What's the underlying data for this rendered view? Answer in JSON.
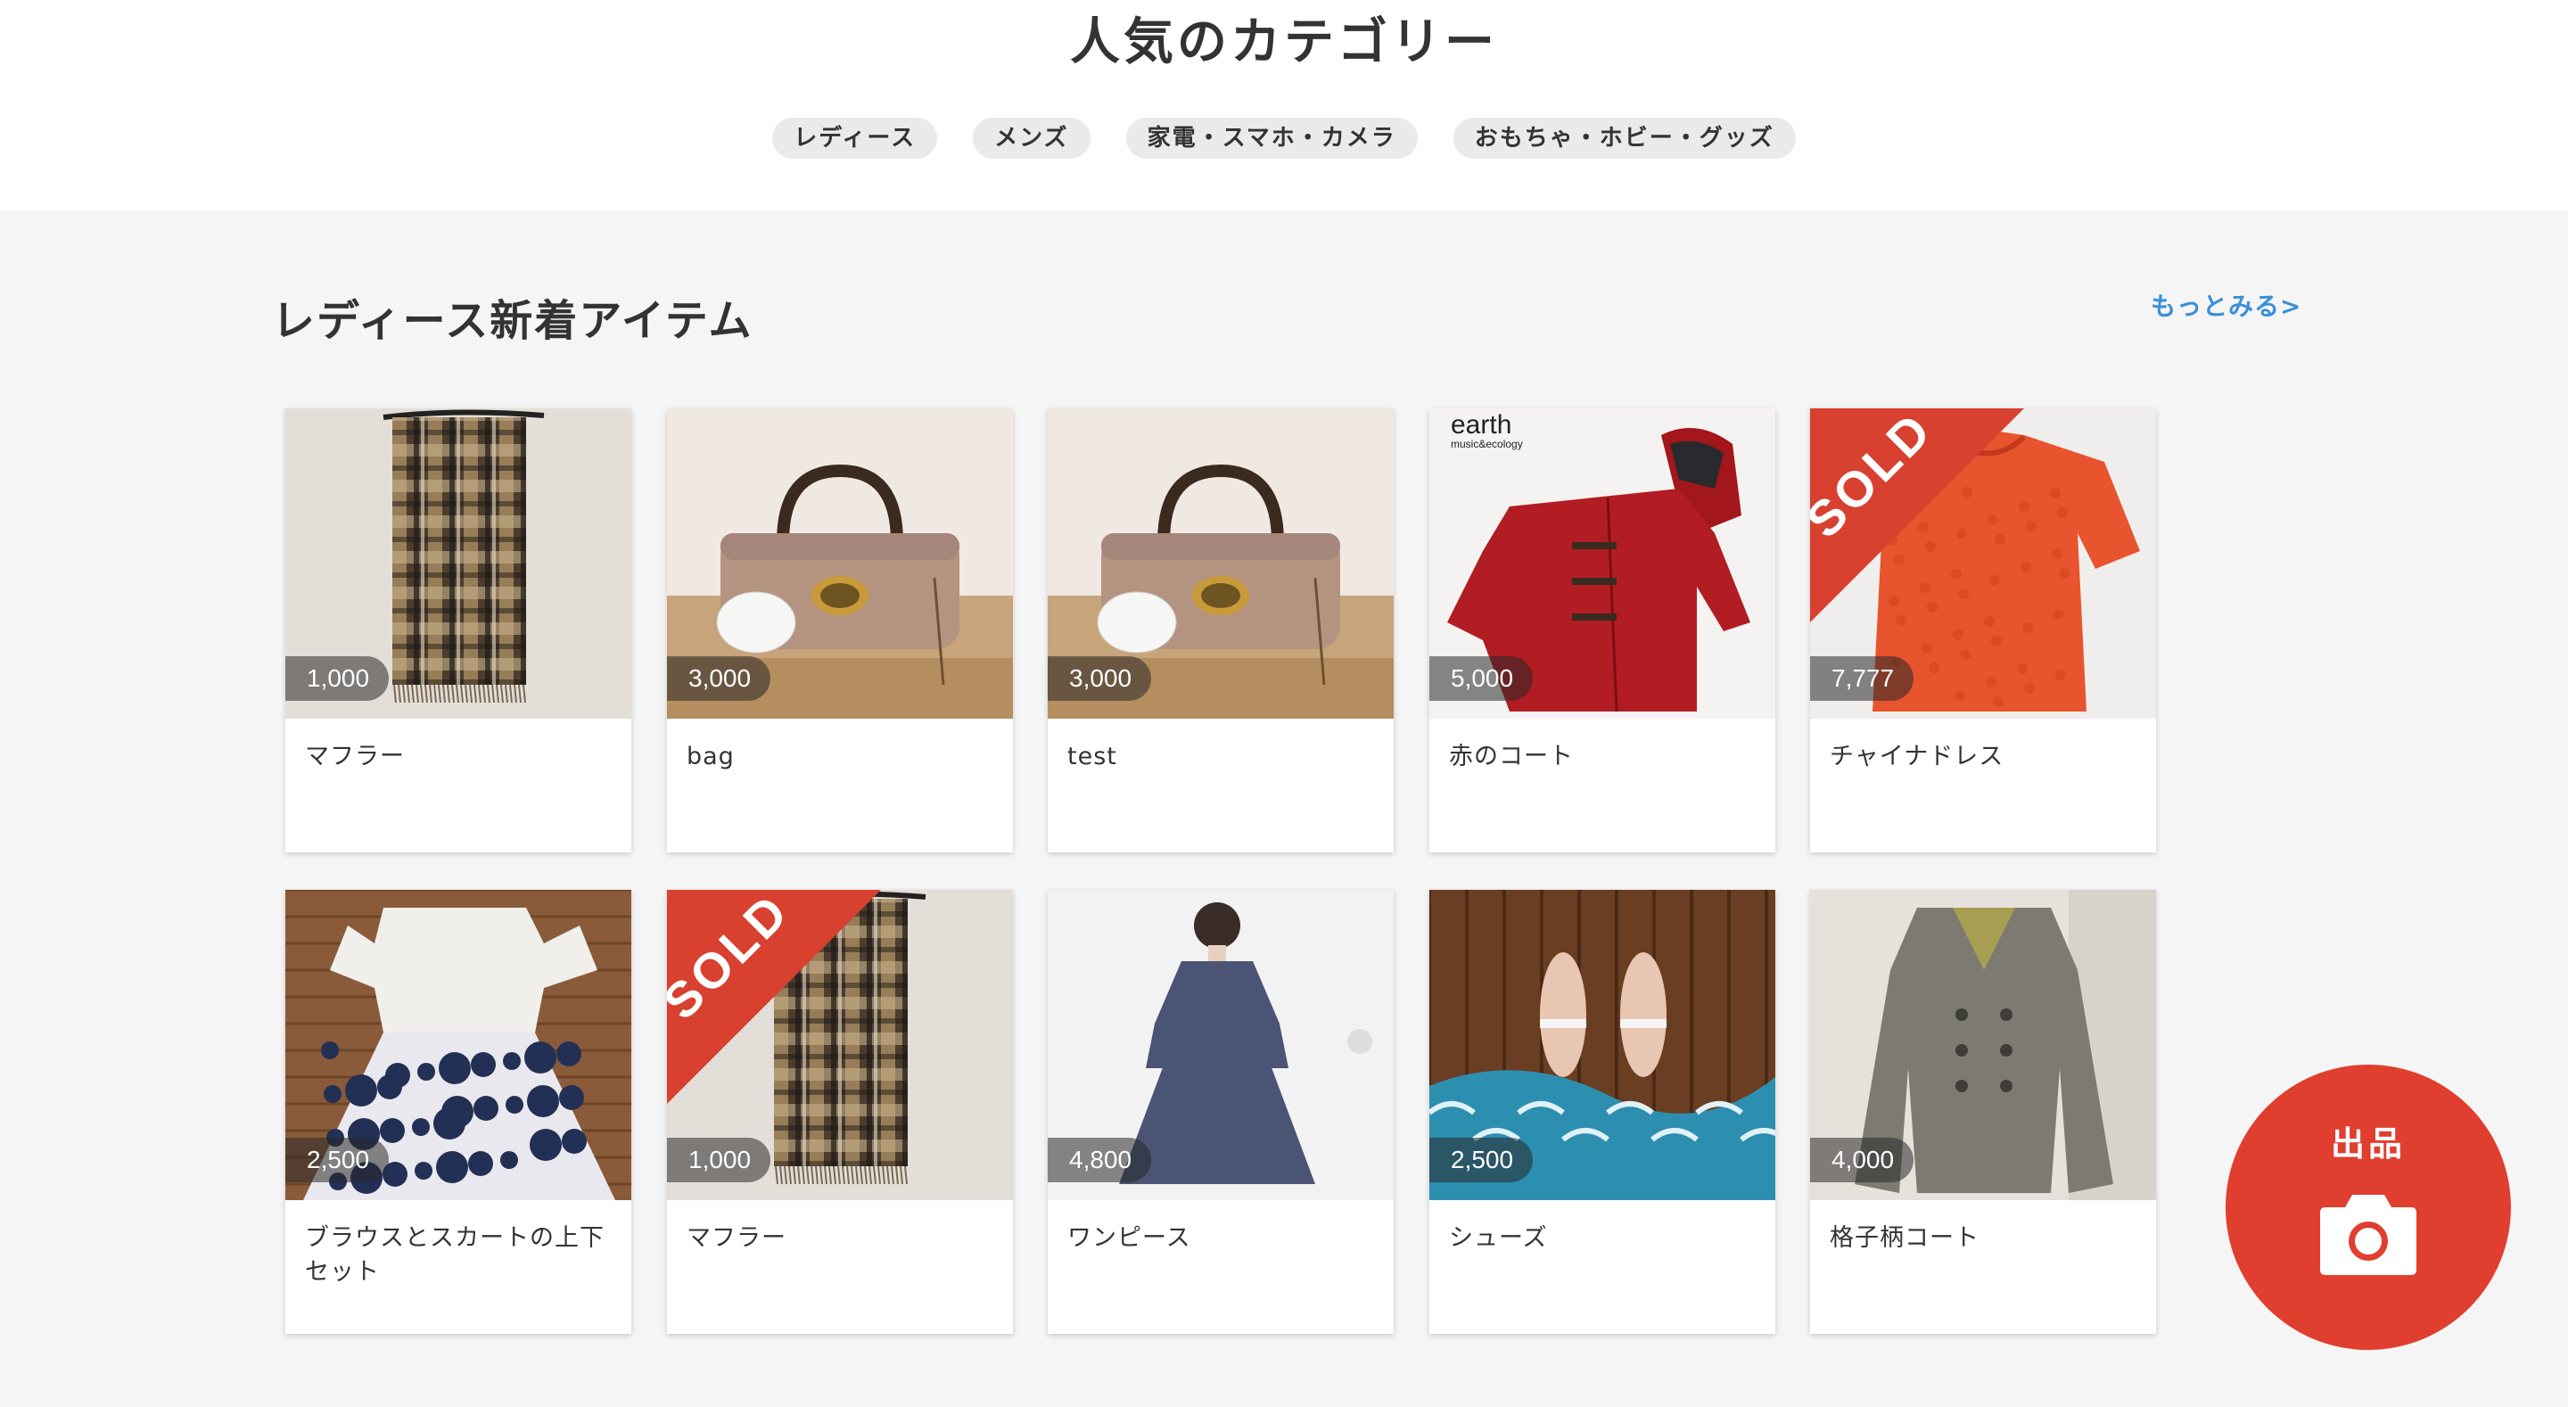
{
  "categories": {
    "title": "人気のカテゴリー",
    "chips": [
      "レディース",
      "メンズ",
      "家電・スマホ・カメラ",
      "おもちゃ・ホビー・グッズ"
    ]
  },
  "section": {
    "title": "レディース新着アイテム",
    "more_link": "もっとみる>"
  },
  "items": [
    {
      "name": "マフラー",
      "price": "1,000",
      "sold": false,
      "image": "scarf"
    },
    {
      "name": "bag",
      "price": "3,000",
      "sold": false,
      "image": "bag"
    },
    {
      "name": "test",
      "price": "3,000",
      "sold": false,
      "image": "bag"
    },
    {
      "name": "赤のコート",
      "price": "5,000",
      "sold": false,
      "image": "red-coat",
      "image_text": "earth",
      "image_subtext": "music&ecology"
    },
    {
      "name": "チャイナドレス",
      "price": "7,777",
      "sold": true,
      "image": "orange-top"
    },
    {
      "name": "ブラウスとスカートの上下セット",
      "price": "2,500",
      "sold": false,
      "image": "blouse-skirt"
    },
    {
      "name": "マフラー",
      "price": "1,000",
      "sold": true,
      "image": "scarf"
    },
    {
      "name": "ワンピース",
      "price": "4,800",
      "sold": false,
      "image": "navy-dress"
    },
    {
      "name": "シューズ",
      "price": "2,500",
      "sold": false,
      "image": "sandals"
    },
    {
      "name": "格子柄コート",
      "price": "4,000",
      "sold": false,
      "image": "grey-coat"
    }
  ],
  "sold_label": "SOLD",
  "fab": {
    "label": "出品",
    "icon": "camera-icon"
  },
  "colors": {
    "accent": "#e03e2f",
    "link": "#3a8fd8",
    "background": "#f5f5f5"
  }
}
